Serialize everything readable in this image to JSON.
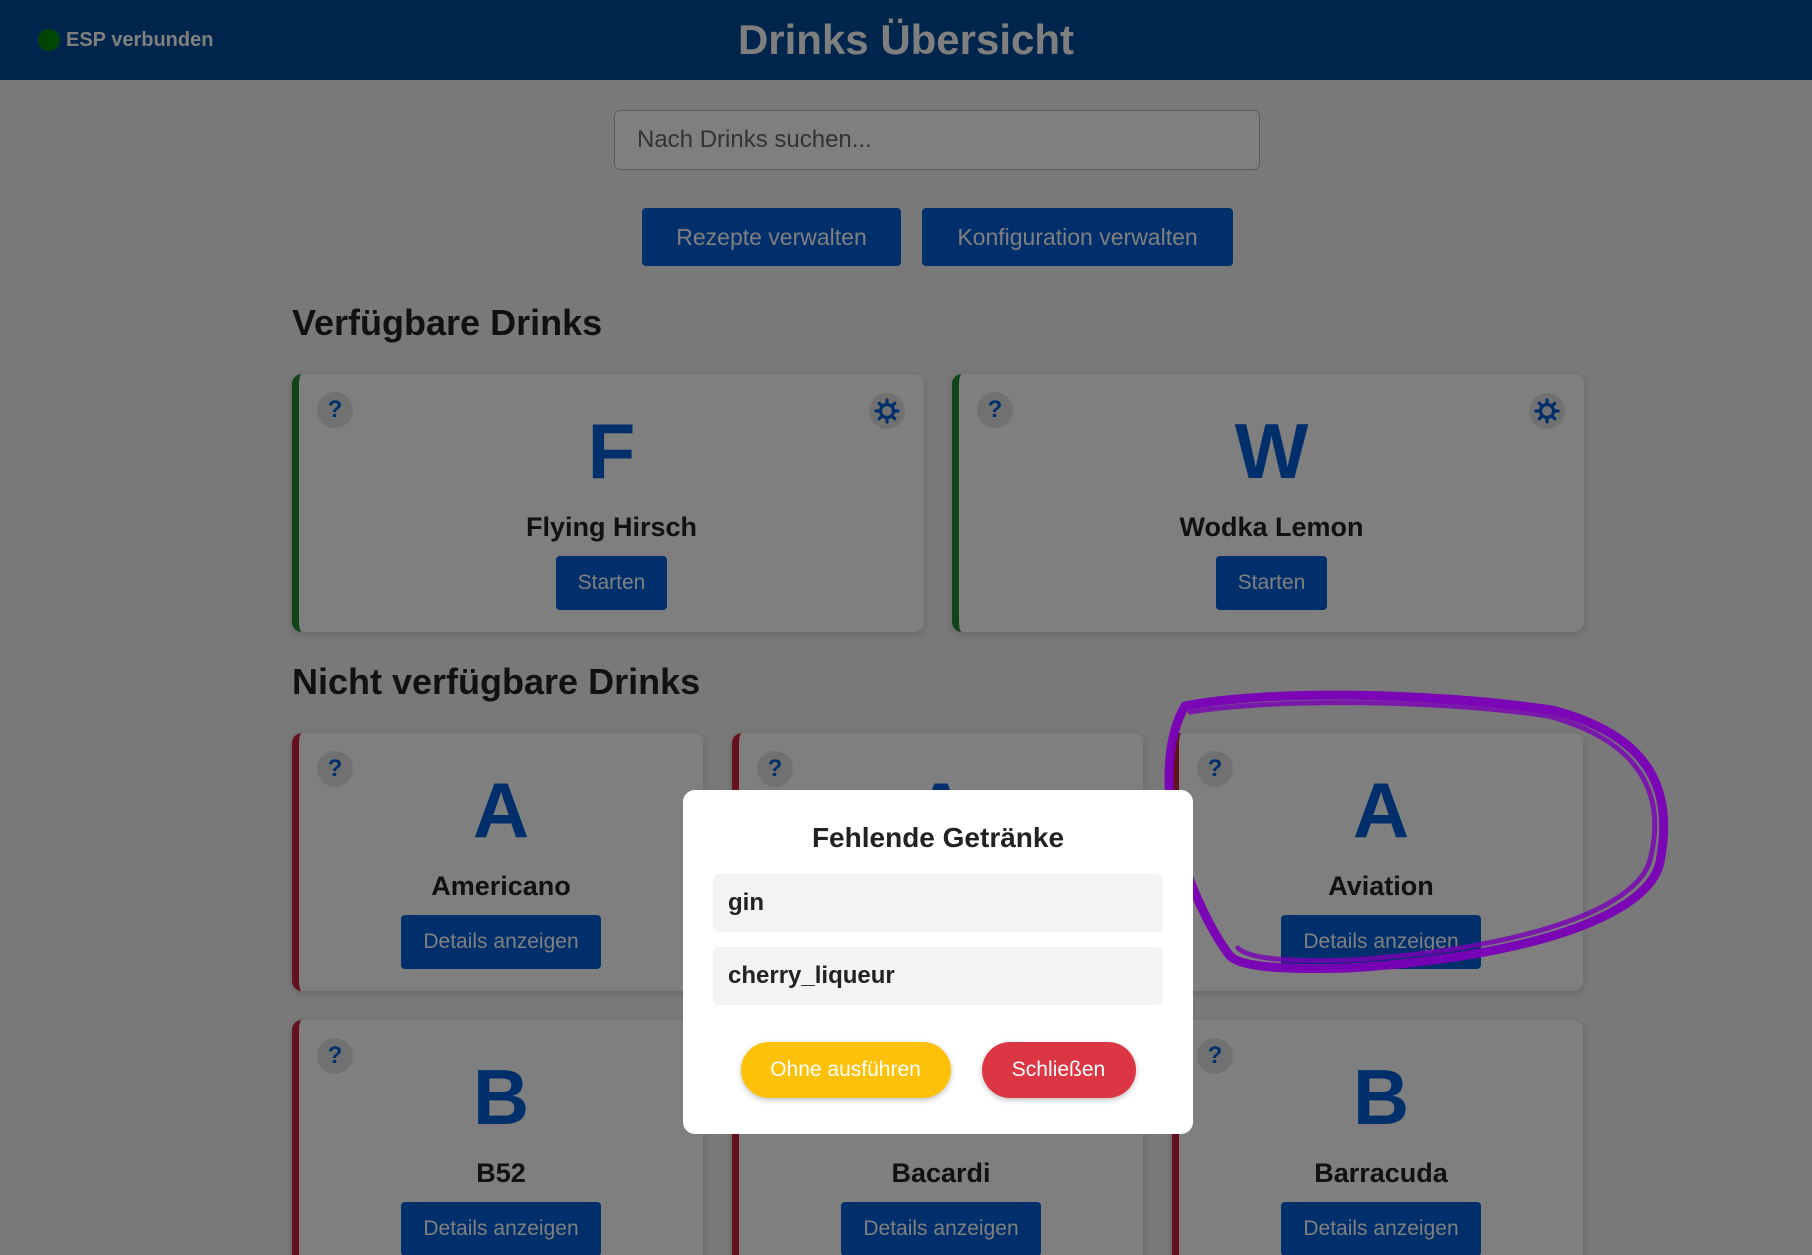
{
  "header": {
    "title": "Drinks Übersicht",
    "esp_status": "ESP verbunden",
    "status_color": "#008a00"
  },
  "search": {
    "placeholder": "Nach Drinks suchen...",
    "value": ""
  },
  "actions": {
    "recipes_label": "Rezepte verwalten",
    "config_label": "Konfiguration verwalten"
  },
  "sections": {
    "available_title": "Verfügbare Drinks",
    "unavailable_title": "Nicht verfügbare Drinks"
  },
  "available_drinks": [
    {
      "letter": "F",
      "name": "Flying Hirsch",
      "button": "Starten"
    },
    {
      "letter": "W",
      "name": "Wodka Lemon",
      "button": "Starten"
    }
  ],
  "unavailable_drinks": [
    {
      "letter": "A",
      "name": "Americano",
      "button": "Details anzeigen"
    },
    {
      "letter": "A",
      "name": "",
      "button": ""
    },
    {
      "letter": "A",
      "name": "Aviation",
      "button": "Details anzeigen"
    },
    {
      "letter": "B",
      "name": "B52",
      "button": "Details anzeigen"
    },
    {
      "letter": "",
      "name": "Bacardi",
      "button": "Details anzeigen"
    },
    {
      "letter": "B",
      "name": "Barracuda",
      "button": "Details anzeigen"
    }
  ],
  "card_help": "?",
  "modal": {
    "title": "Fehlende Getränke",
    "items": [
      "gin",
      "cherry_liqueur"
    ],
    "run_anyway_label": "Ohne ausführen",
    "close_label": "Schließen"
  },
  "colors": {
    "header": "#004a99",
    "primary": "#005ed6",
    "available_border": "#1e8a33",
    "unavailable_border": "#c8213a",
    "warning": "#fdc10a",
    "danger": "#dc3645",
    "annotation": "#7a00b8"
  },
  "icons": {
    "help": "question-mark-icon",
    "settings": "gear-icon",
    "status": "status-dot-icon"
  }
}
